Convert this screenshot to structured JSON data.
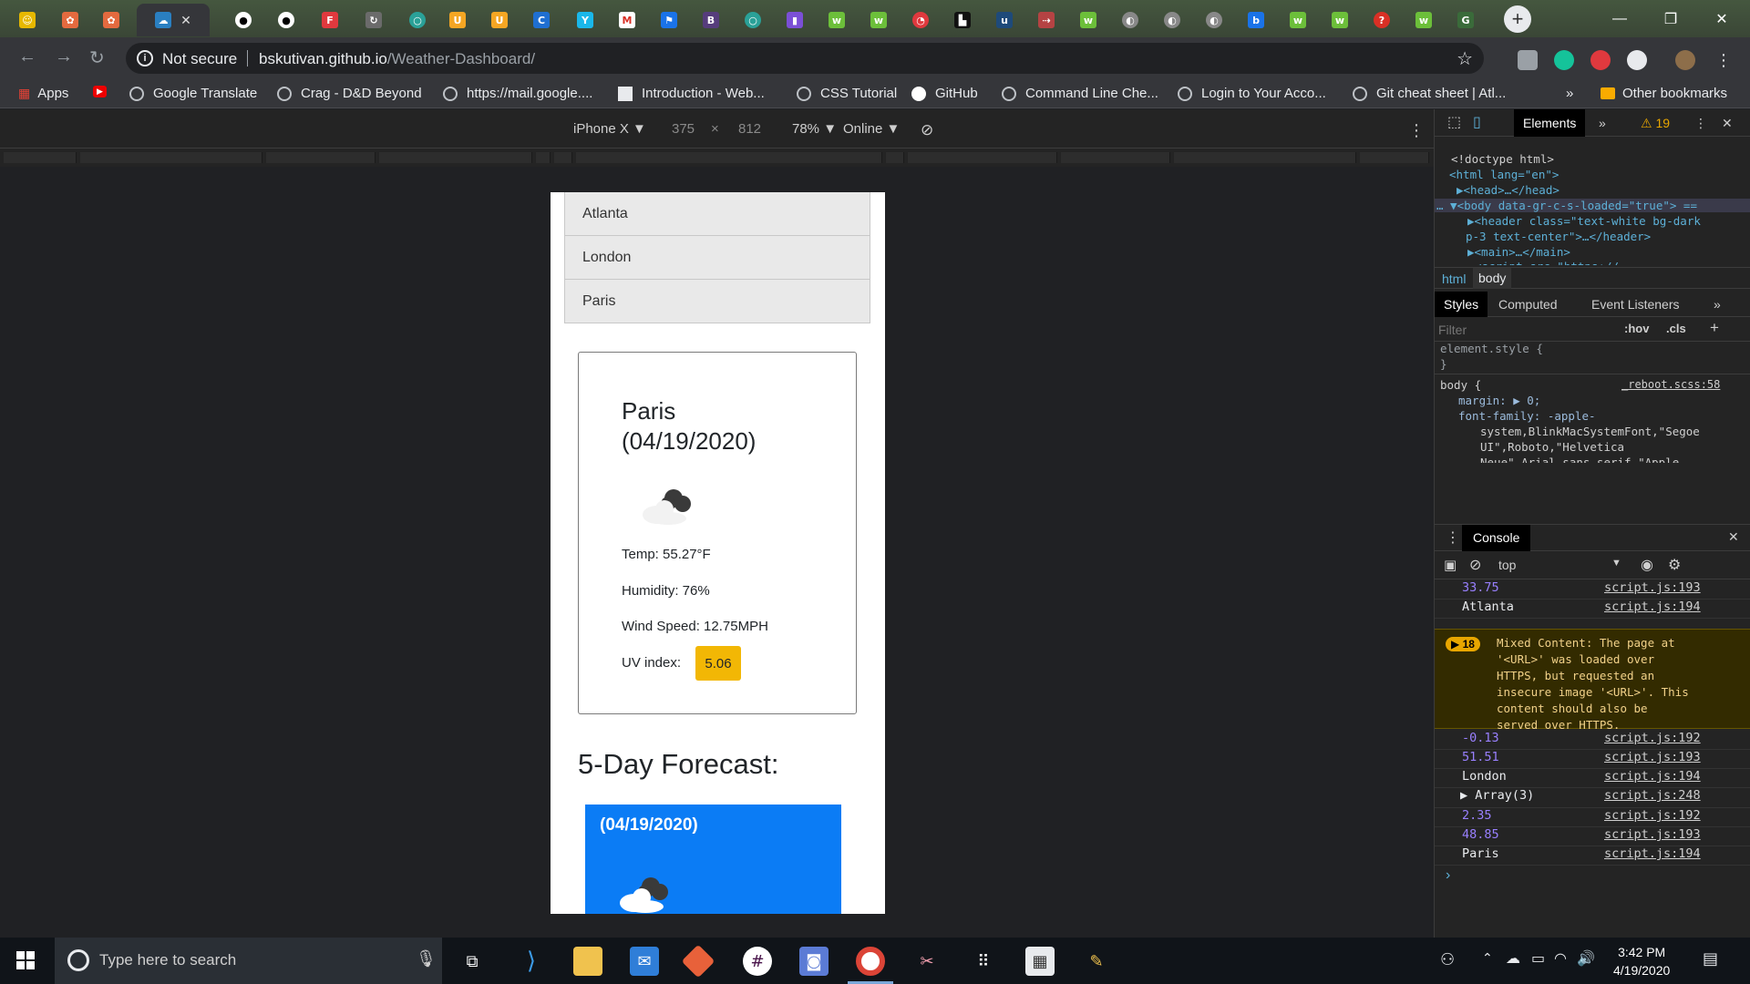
{
  "browser": {
    "security_label": "Not secure",
    "url_host": "bskutivan.github.io",
    "url_path": "/Weather-Dashboard/",
    "active_tab_close": "✕",
    "bookmarks": [
      {
        "label": "Apps"
      },
      {
        "label": ""
      },
      {
        "label": "Google Translate"
      },
      {
        "label": "Crag - D&D Beyond"
      },
      {
        "label": "https://mail.google...."
      },
      {
        "label": "Introduction - Web..."
      },
      {
        "label": "CSS Tutorial"
      },
      {
        "label": "GitHub"
      },
      {
        "label": "Command Line Che..."
      },
      {
        "label": "Login to Your Acco..."
      },
      {
        "label": "Git cheat sheet | Atl..."
      },
      {
        "label": "Other bookmarks"
      }
    ],
    "bookmarks_overflow": "»"
  },
  "device_toolbar": {
    "device": "iPhone X ▼",
    "width": "375",
    "times": "×",
    "height": "812",
    "zoom": "78% ▼",
    "network": "Online ▼"
  },
  "page": {
    "cities": [
      "Atlanta",
      "London",
      "Paris"
    ],
    "current": {
      "city_date_line1": "Paris",
      "city_date_line2": "(04/19/2020)",
      "temp": "Temp: 55.27°F",
      "humidity": "Humidity: 76%",
      "wind": "Wind Speed: 12.75MPH",
      "uv_label": "UV index:",
      "uv_value": "5.06",
      "uv_color": "#f2b705"
    },
    "forecast_title": "5-Day Forecast:",
    "forecast_cards": [
      {
        "date": "(04/19/2020)",
        "color": "#0b7cf5"
      }
    ]
  },
  "devtools": {
    "tabs": {
      "elements": "Elements",
      "overflow": "»",
      "warnings": "⚠ 19"
    },
    "dom": {
      "doctype": "<!doctype html>",
      "html_open": "<html lang=\"en\">",
      "head": "▶<head>…</head>",
      "body": "… ▼<body data-gr-c-s-loaded=\"true\"> ==",
      "header_l1": "▶<header class=\"text-white bg-dark",
      "header_l2": "p-3 text-center\">…</header>",
      "main": "▶<main>…</main>",
      "script": "<script src=\"https://"
    },
    "breadcrumb": [
      "html",
      "body"
    ],
    "style_tabs": [
      "Styles",
      "Computed",
      "Event Listeners",
      "»"
    ],
    "filter_placeholder": "Filter",
    "hov": ":hov",
    "cls": ".cls",
    "plus": "+",
    "element_style_open": "element.style {",
    "element_style_close": "}",
    "body_rule": "body {",
    "body_source": "_reboot.scss:58",
    "margin_line": "margin: ▶ 0;",
    "font_line1": "font-family: -apple-",
    "font_line2": "system,BlinkMacSystemFont,\"Segoe",
    "font_line3": "UI\",Roboto,\"Helvetica",
    "font_line4": "Neue\",Arial,sans-serif,\"Apple",
    "console_label": "Console",
    "context": "top",
    "console_lines": [
      {
        "value": "33.75",
        "source": "script.js:193",
        "kind": "num"
      },
      {
        "value": "Atlanta",
        "source": "script.js:194",
        "kind": "str"
      },
      {
        "value": "-0.13",
        "source": "script.js:192",
        "kind": "num"
      },
      {
        "value": "51.51",
        "source": "script.js:193",
        "kind": "num"
      },
      {
        "value": "London",
        "source": "script.js:194",
        "kind": "str"
      },
      {
        "value": "▶ Array(3)",
        "source": "script.js:248",
        "kind": "str"
      },
      {
        "value": "2.35",
        "source": "script.js:192",
        "kind": "num"
      },
      {
        "value": "48.85",
        "source": "script.js:193",
        "kind": "num"
      },
      {
        "value": "Paris",
        "source": "script.js:194",
        "kind": "str"
      }
    ],
    "warning_count": "▶ 18",
    "warning_text": "Mixed Content: The page at\n'<URL>' was loaded over\nHTTPS, but requested an\ninsecure image '<URL>'. This\ncontent should also be\nserved over HTTPS.",
    "prompt": "›"
  },
  "taskbar": {
    "search_placeholder": "Type here to search",
    "time": "3:42 PM",
    "date": "4/19/2020"
  }
}
